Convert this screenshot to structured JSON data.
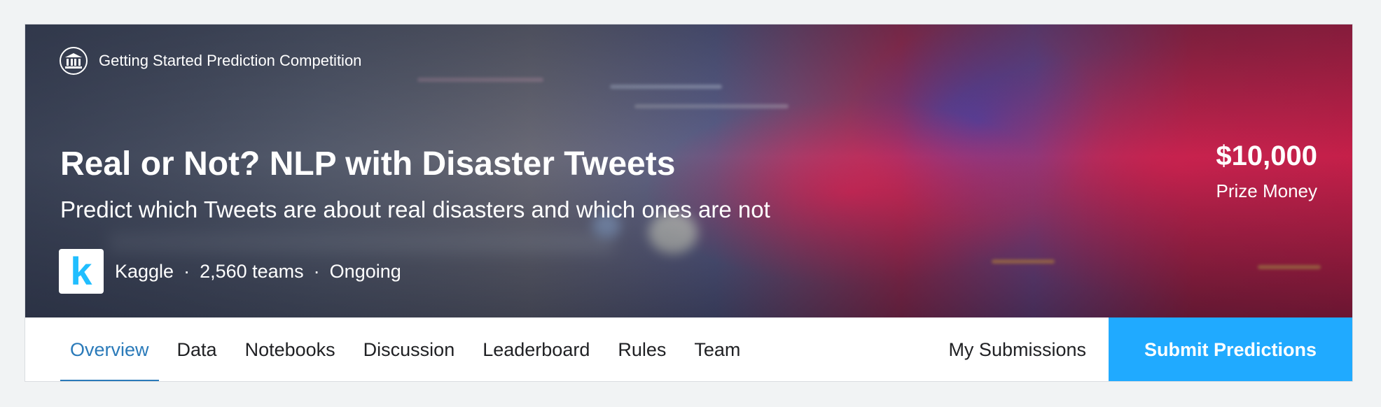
{
  "competition": {
    "type_label": "Getting Started Prediction Competition",
    "title": "Real or Not? NLP with Disaster Tweets",
    "subtitle": "Predict which Tweets are about real disasters and which ones are not",
    "host": "Kaggle",
    "host_logo_letter": "k",
    "teams": "2,560 teams",
    "status": "Ongoing",
    "separator": "·",
    "prize_amount": "$10,000",
    "prize_label": "Prize Money"
  },
  "nav": {
    "tabs": [
      {
        "label": "Overview",
        "active": true
      },
      {
        "label": "Data"
      },
      {
        "label": "Notebooks"
      },
      {
        "label": "Discussion"
      },
      {
        "label": "Leaderboard"
      },
      {
        "label": "Rules"
      },
      {
        "label": "Team"
      }
    ],
    "my_submissions": "My Submissions",
    "submit_predictions": "Submit Predictions"
  },
  "icons": {
    "competition_type": "institution-icon",
    "host_logo": "kaggle-logo"
  },
  "colors": {
    "accent": "#2a7ab9",
    "submit_bg": "#20aaff",
    "kaggle_blue": "#20beff"
  }
}
